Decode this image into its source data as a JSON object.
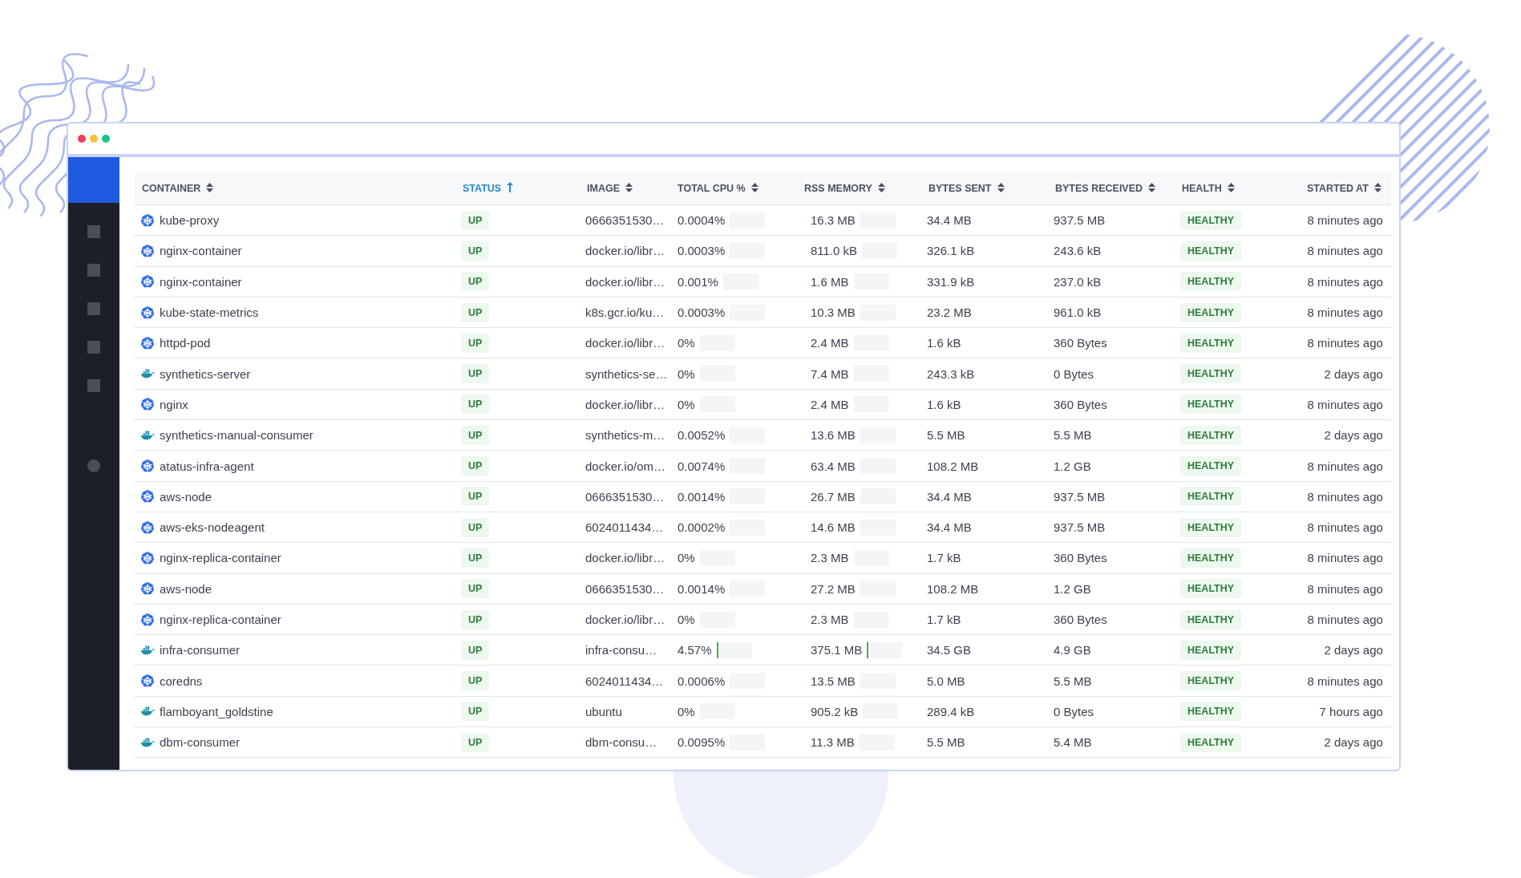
{
  "columns": [
    {
      "label": "CONTAINER",
      "sorted": false
    },
    {
      "label": "STATUS",
      "sorted": true
    },
    {
      "label": "IMAGE",
      "sorted": false
    },
    {
      "label": "TOTAL CPU %",
      "sorted": false
    },
    {
      "label": "RSS MEMORY",
      "sorted": false
    },
    {
      "label": "BYTES SENT",
      "sorted": false
    },
    {
      "label": "BYTES RECEIVED",
      "sorted": false
    },
    {
      "label": "HEALTH",
      "sorted": false
    },
    {
      "label": "STARTED AT",
      "sorted": false
    }
  ],
  "rows": [
    {
      "kind": "kubernetes",
      "name": "kube-proxy",
      "status": "UP",
      "image": "0666351530…",
      "cpu": {
        "text": "0.0004%",
        "level": 0
      },
      "memory": {
        "text": "16.3 MB",
        "level": 0
      },
      "sent": "34.4 MB",
      "received": "937.5 MB",
      "health": "HEALTHY",
      "started": "8 minutes ago"
    },
    {
      "kind": "kubernetes",
      "name": "nginx-container",
      "status": "UP",
      "image": "docker.io/libr…",
      "cpu": {
        "text": "0.0003%",
        "level": 0
      },
      "memory": {
        "text": "811.0 kB",
        "level": 0
      },
      "sent": "326.1 kB",
      "received": "243.6 kB",
      "health": "HEALTHY",
      "started": "8 minutes ago"
    },
    {
      "kind": "kubernetes",
      "name": "nginx-container",
      "status": "UP",
      "image": "docker.io/libr…",
      "cpu": {
        "text": "0.001%",
        "level": 0
      },
      "memory": {
        "text": "1.6 MB",
        "level": 0
      },
      "sent": "331.9 kB",
      "received": "237.0 kB",
      "health": "HEALTHY",
      "started": "8 minutes ago"
    },
    {
      "kind": "kubernetes",
      "name": "kube-state-metrics",
      "status": "UP",
      "image": "k8s.gcr.io/ku…",
      "cpu": {
        "text": "0.0003%",
        "level": 0
      },
      "memory": {
        "text": "10.3 MB",
        "level": 0
      },
      "sent": "23.2 MB",
      "received": "961.0 kB",
      "health": "HEALTHY",
      "started": "8 minutes ago"
    },
    {
      "kind": "kubernetes",
      "name": "httpd-pod",
      "status": "UP",
      "image": "docker.io/libr…",
      "cpu": {
        "text": "0%",
        "level": 0
      },
      "memory": {
        "text": "2.4 MB",
        "level": 0
      },
      "sent": "1.6 kB",
      "received": "360 Bytes",
      "health": "HEALTHY",
      "started": "8 minutes ago"
    },
    {
      "kind": "docker",
      "name": "synthetics-server",
      "status": "UP",
      "image": "synthetics-se…",
      "cpu": {
        "text": "0%",
        "level": 0
      },
      "memory": {
        "text": "7.4 MB",
        "level": 0
      },
      "sent": "243.3 kB",
      "received": "0 Bytes",
      "health": "HEALTHY",
      "started": "2 days ago"
    },
    {
      "kind": "kubernetes",
      "name": "nginx",
      "status": "UP",
      "image": "docker.io/libr…",
      "cpu": {
        "text": "0%",
        "level": 0
      },
      "memory": {
        "text": "2.4 MB",
        "level": 0
      },
      "sent": "1.6 kB",
      "received": "360 Bytes",
      "health": "HEALTHY",
      "started": "8 minutes ago"
    },
    {
      "kind": "docker",
      "name": "synthetics-manual-consumer",
      "status": "UP",
      "image": "synthetics-m…",
      "cpu": {
        "text": "0.0052%",
        "level": 0
      },
      "memory": {
        "text": "13.6 MB",
        "level": 0
      },
      "sent": "5.5 MB",
      "received": "5.5 MB",
      "health": "HEALTHY",
      "started": "2 days ago"
    },
    {
      "kind": "kubernetes",
      "name": "atatus-infra-agent",
      "status": "UP",
      "image": "docker.io/om…",
      "cpu": {
        "text": "0.0074%",
        "level": 0
      },
      "memory": {
        "text": "63.4 MB",
        "level": 0
      },
      "sent": "108.2 MB",
      "received": "1.2 GB",
      "health": "HEALTHY",
      "started": "8 minutes ago"
    },
    {
      "kind": "kubernetes",
      "name": "aws-node",
      "status": "UP",
      "image": "0666351530…",
      "cpu": {
        "text": "0.0014%",
        "level": 0
      },
      "memory": {
        "text": "26.7 MB",
        "level": 0
      },
      "sent": "34.4 MB",
      "received": "937.5 MB",
      "health": "HEALTHY",
      "started": "8 minutes ago"
    },
    {
      "kind": "kubernetes",
      "name": "aws-eks-nodeagent",
      "status": "UP",
      "image": "6024011434…",
      "cpu": {
        "text": "0.0002%",
        "level": 0
      },
      "memory": {
        "text": "14.6 MB",
        "level": 0
      },
      "sent": "34.4 MB",
      "received": "937.5 MB",
      "health": "HEALTHY",
      "started": "8 minutes ago"
    },
    {
      "kind": "kubernetes",
      "name": "nginx-replica-container",
      "status": "UP",
      "image": "docker.io/libr…",
      "cpu": {
        "text": "0%",
        "level": 0
      },
      "memory": {
        "text": "2.3 MB",
        "level": 0
      },
      "sent": "1.7 kB",
      "received": "360 Bytes",
      "health": "HEALTHY",
      "started": "8 minutes ago"
    },
    {
      "kind": "kubernetes",
      "name": "aws-node",
      "status": "UP",
      "image": "0666351530…",
      "cpu": {
        "text": "0.0014%",
        "level": 0
      },
      "memory": {
        "text": "27.2 MB",
        "level": 0
      },
      "sent": "108.2 MB",
      "received": "1.2 GB",
      "health": "HEALTHY",
      "started": "8 minutes ago"
    },
    {
      "kind": "kubernetes",
      "name": "nginx-replica-container",
      "status": "UP",
      "image": "docker.io/libr…",
      "cpu": {
        "text": "0%",
        "level": 0
      },
      "memory": {
        "text": "2.3 MB",
        "level": 0
      },
      "sent": "1.7 kB",
      "received": "360 Bytes",
      "health": "HEALTHY",
      "started": "8 minutes ago"
    },
    {
      "kind": "docker",
      "name": "infra-consumer",
      "status": "UP",
      "image": "infra-consu…",
      "cpu": {
        "text": "4.57%",
        "level": 0.05
      },
      "memory": {
        "text": "375.1 MB",
        "level": 0.04
      },
      "sent": "34.5 GB",
      "received": "4.9 GB",
      "health": "HEALTHY",
      "started": "2 days ago"
    },
    {
      "kind": "kubernetes",
      "name": "coredns",
      "status": "UP",
      "image": "6024011434…",
      "cpu": {
        "text": "0.0006%",
        "level": 0
      },
      "memory": {
        "text": "13.5 MB",
        "level": 0
      },
      "sent": "5.0 MB",
      "received": "5.5 MB",
      "health": "HEALTHY",
      "started": "8 minutes ago"
    },
    {
      "kind": "docker",
      "name": "flamboyant_goldstine",
      "status": "UP",
      "image": "ubuntu",
      "cpu": {
        "text": "0%",
        "level": 0
      },
      "memory": {
        "text": "905.2 kB",
        "level": 0
      },
      "sent": "289.4 kB",
      "received": "0 Bytes",
      "health": "HEALTHY",
      "started": "7 hours ago"
    },
    {
      "kind": "docker",
      "name": "dbm-consumer",
      "status": "UP",
      "image": "dbm-consu…",
      "cpu": {
        "text": "0.0095%",
        "level": 0
      },
      "memory": {
        "text": "11.3 MB",
        "level": 0
      },
      "sent": "5.5 MB",
      "received": "5.4 MB",
      "health": "HEALTHY",
      "started": "2 days ago"
    }
  ]
}
